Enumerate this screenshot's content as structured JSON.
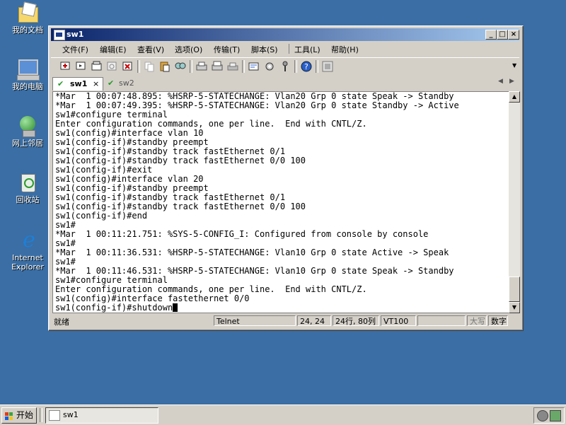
{
  "desktop": {
    "icons": [
      {
        "label": "我的文档"
      },
      {
        "label": "我的电脑"
      },
      {
        "label": "网上邻居"
      },
      {
        "label": "回收站"
      },
      {
        "label": "Internet Explorer"
      }
    ]
  },
  "window": {
    "title": "sw1",
    "controls": {
      "minimize": "_",
      "maximize": "□",
      "close": "×"
    },
    "menu": [
      "文件(F)",
      "编辑(E)",
      "查看(V)",
      "选项(O)",
      "传输(T)",
      "脚本(S)",
      "工具(L)",
      "帮助(H)"
    ],
    "tabs": [
      {
        "label": "sw1",
        "close": "×"
      },
      {
        "label": "sw2"
      }
    ],
    "terminal_lines": [
      "*Mar  1 00:07:48.895: %HSRP-5-STATECHANGE: Vlan20 Grp 0 state Speak -> Standby",
      "*Mar  1 00:07:49.395: %HSRP-5-STATECHANGE: Vlan20 Grp 0 state Standby -> Active",
      "sw1#configure terminal",
      "Enter configuration commands, one per line.  End with CNTL/Z.",
      "sw1(config)#interface vlan 10",
      "sw1(config-if)#standby preempt",
      "sw1(config-if)#standby track fastEthernet 0/1",
      "sw1(config-if)#standby track fastEthernet 0/0 100",
      "sw1(config-if)#exit",
      "sw1(config)#interface vlan 20",
      "sw1(config-if)#standby preempt",
      "sw1(config-if)#standby track fastEthernet 0/1",
      "sw1(config-if)#standby track fastEthernet 0/0 100",
      "sw1(config-if)#end",
      "sw1#",
      "*Mar  1 00:11:21.751: %SYS-5-CONFIG_I: Configured from console by console",
      "sw1#",
      "*Mar  1 00:11:36.531: %HSRP-5-STATECHANGE: Vlan10 Grp 0 state Active -> Speak",
      "sw1#",
      "*Mar  1 00:11:46.531: %HSRP-5-STATECHANGE: Vlan10 Grp 0 state Speak -> Standby",
      "sw1#configure terminal",
      "Enter configuration commands, one per line.  End with CNTL/Z.",
      "sw1(config)#interface fastethernet 0/0",
      "sw1(config-if)#shutdown"
    ],
    "status": {
      "ready": "就绪",
      "protocol": "Telnet",
      "cursor_pos": "24, 24",
      "size": "24行, 80列",
      "emulation": "VT100",
      "caps": "大写",
      "num": "数字"
    }
  },
  "taskbar": {
    "start_label": "开始",
    "task_label": "sw1"
  },
  "colors": {
    "desktop": "#3a6ea5",
    "titlebar_start": "#0a246a",
    "titlebar_end": "#a6caf0"
  }
}
